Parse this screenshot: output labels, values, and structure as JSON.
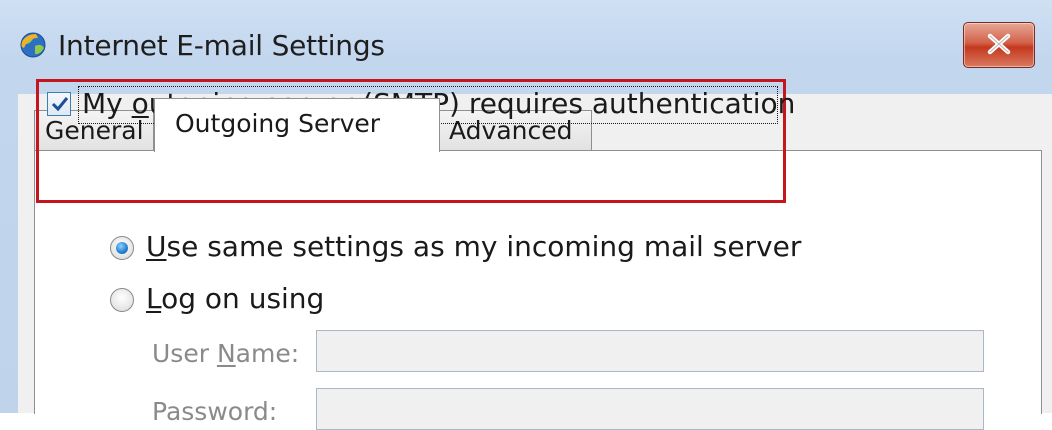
{
  "window": {
    "title": "Internet E-mail Settings",
    "icons": {
      "app": "outlook-globe-icon",
      "close": "close-icon"
    }
  },
  "tabs": [
    {
      "label": "General",
      "selected": false
    },
    {
      "label": "Outgoing Server",
      "selected": true
    },
    {
      "label": "Advanced",
      "selected": false
    }
  ],
  "outgoing": {
    "auth_checkbox": {
      "prefix": "My ",
      "mnemonic": "o",
      "suffix": "utgoing server (SMTP) requires authentication",
      "checked": true
    },
    "same_settings": {
      "mnemonic": "U",
      "suffix": "se same settings as my incoming mail server",
      "selected": true
    },
    "log_on": {
      "mnemonic": "L",
      "suffix": "og on using",
      "selected": false
    },
    "user_name": {
      "prefix": "User ",
      "mnemonic": "N",
      "suffix": "ame:",
      "value": ""
    },
    "password": {
      "label": "Password:",
      "value": ""
    }
  },
  "colors": {
    "highlight_border": "#c4161c",
    "radio_selected": "#2a85d3",
    "close_button": "#c4381f"
  }
}
